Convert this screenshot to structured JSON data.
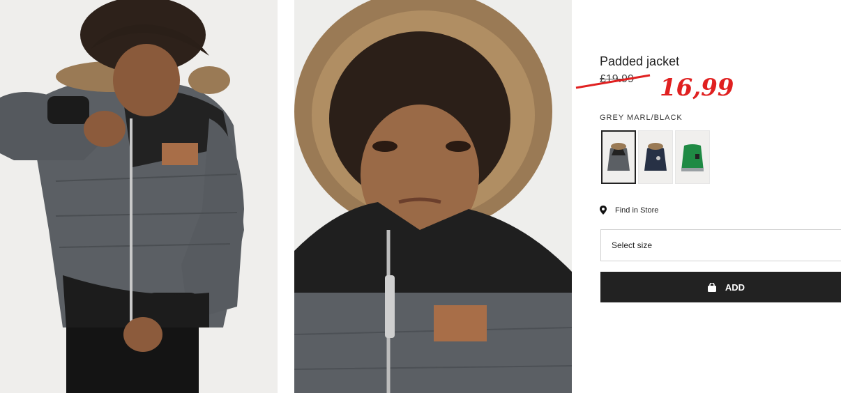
{
  "product": {
    "title": "Padded jacket",
    "old_price": "£19.99",
    "new_price": "16,99",
    "color_name": "GREY MARL/BLACK",
    "price_color": "#e02020"
  },
  "swatches": [
    {
      "name": "grey-marl-black",
      "selected": true
    },
    {
      "name": "navy",
      "selected": false
    },
    {
      "name": "green",
      "selected": false
    }
  ],
  "actions": {
    "find_in_store": "Find in Store",
    "select_size": "Select size",
    "add": "ADD"
  },
  "icons": {
    "location": "location-pin-icon",
    "bag": "shopping-bag-icon"
  },
  "colors": {
    "add_button_bg": "#222222",
    "photo_bg": "#eeeeec",
    "jacket_grey": "#5b5f64",
    "jacket_black": "#1f1f1f",
    "fur": "#9a7a55"
  }
}
